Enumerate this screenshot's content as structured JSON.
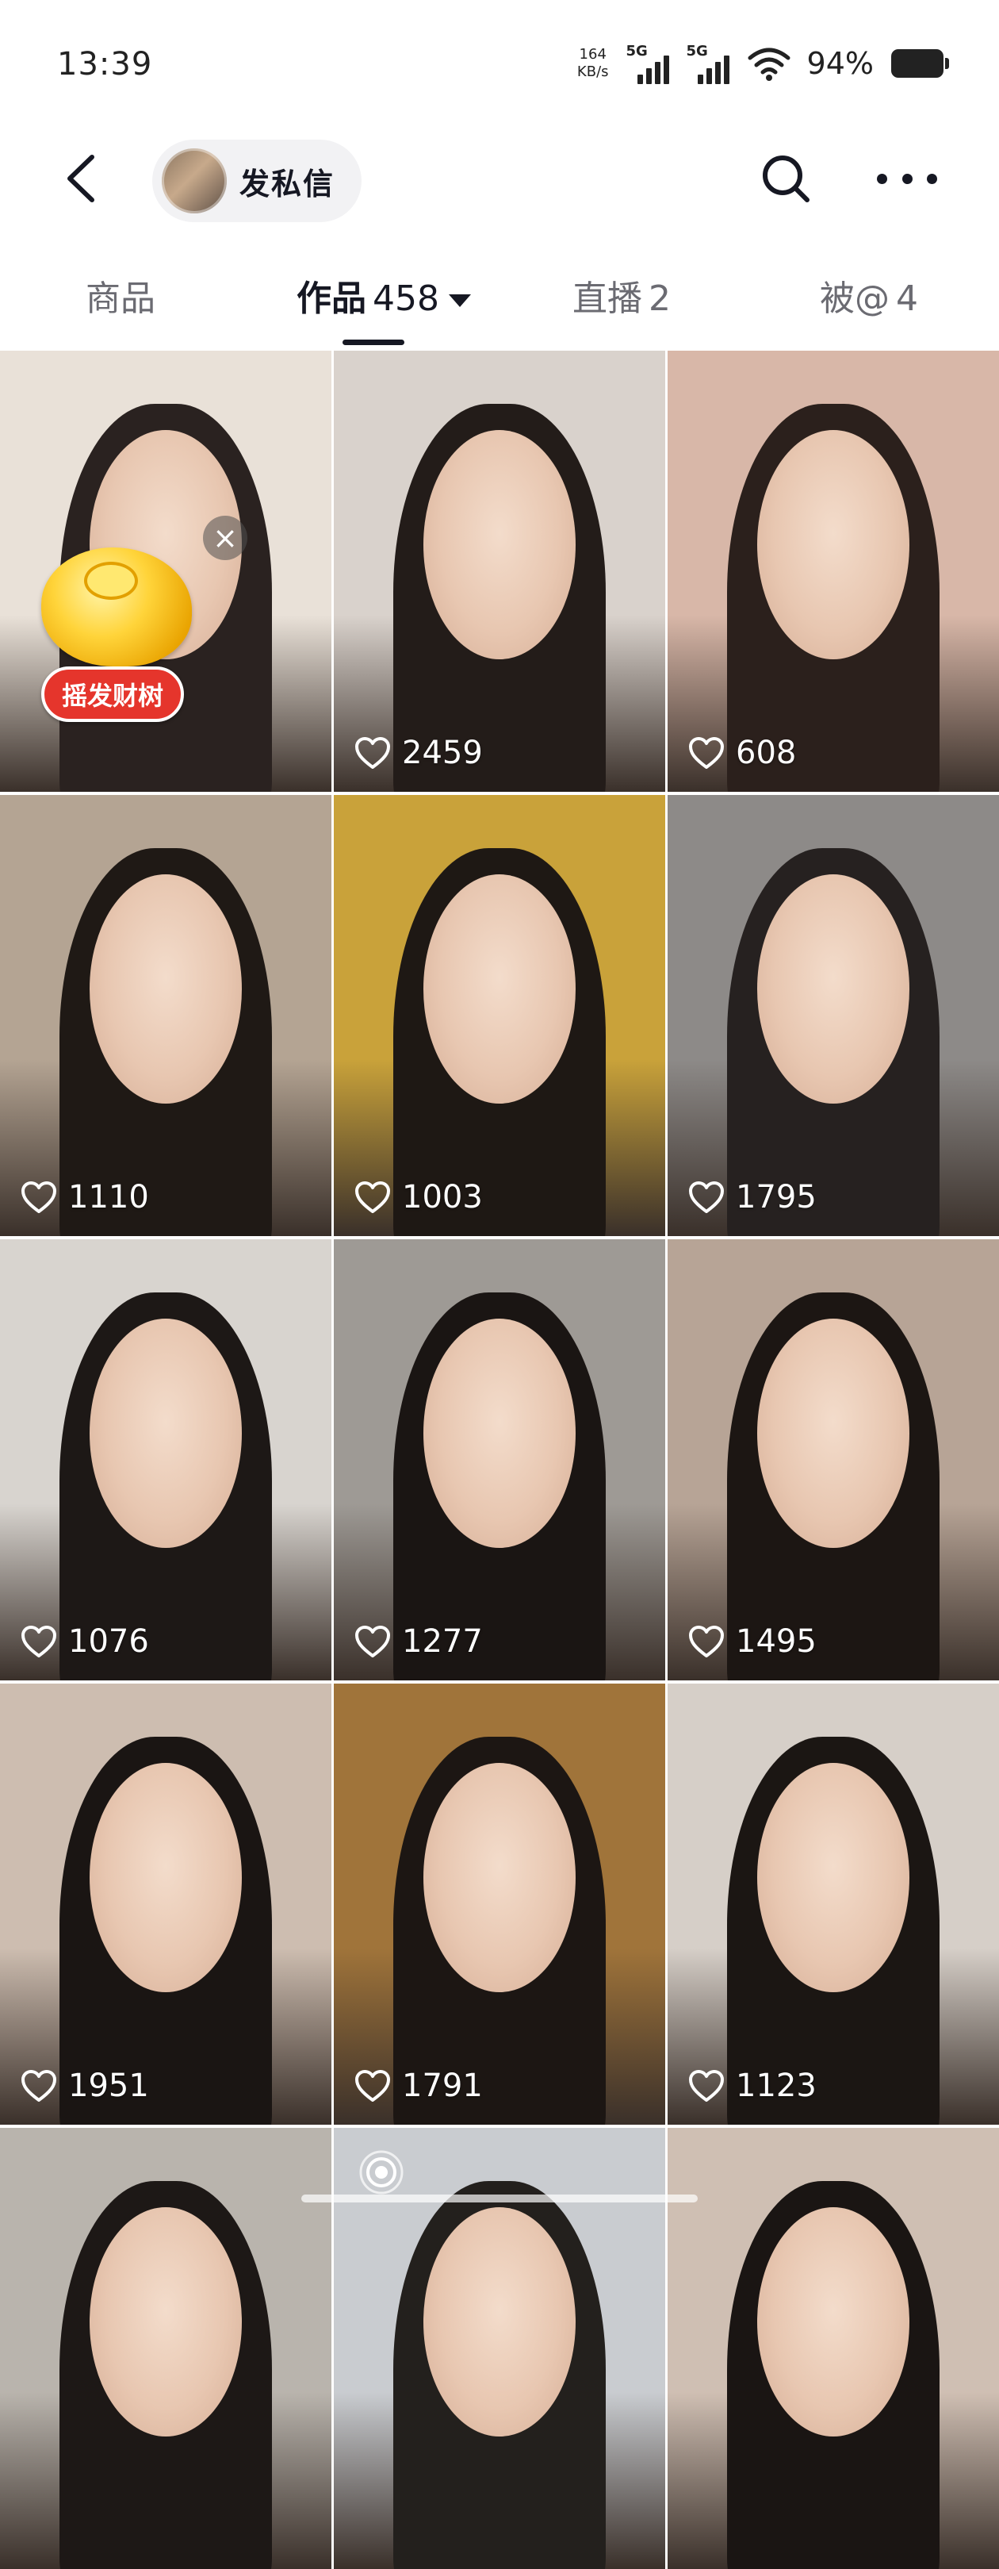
{
  "status_bar": {
    "time": "13:39",
    "net_speed_value": "164",
    "net_speed_unit": "KB/s",
    "sim1_label": "5G",
    "sim2_label": "5G",
    "battery_percent": "94%"
  },
  "header": {
    "back_icon": "chevron-left-icon",
    "dm_label": "发私信",
    "search_icon": "search-icon",
    "more_icon": "more-horizontal-icon"
  },
  "tabs": [
    {
      "label": "商品",
      "count": "",
      "active": false
    },
    {
      "label": "作品",
      "count": "458",
      "active": true
    },
    {
      "label": "直播",
      "count": "2",
      "active": false
    },
    {
      "label": "被@",
      "count": "4",
      "active": false
    }
  ],
  "videos": [
    {
      "likes": ""
    },
    {
      "likes": "2459"
    },
    {
      "likes": "608"
    },
    {
      "likes": "1110"
    },
    {
      "likes": "1003"
    },
    {
      "likes": "1795"
    },
    {
      "likes": "1076"
    },
    {
      "likes": "1277"
    },
    {
      "likes": "1495"
    },
    {
      "likes": "1951"
    },
    {
      "likes": "1791"
    },
    {
      "likes": "1123"
    },
    {
      "likes": ""
    },
    {
      "likes": ""
    },
    {
      "likes": ""
    }
  ],
  "promo": {
    "label": "摇发财树",
    "close_icon": "close-icon"
  },
  "colors": {
    "accent_text": "#161823",
    "inactive_tab": "#6b6b72",
    "promo_red": "#e5352c"
  }
}
